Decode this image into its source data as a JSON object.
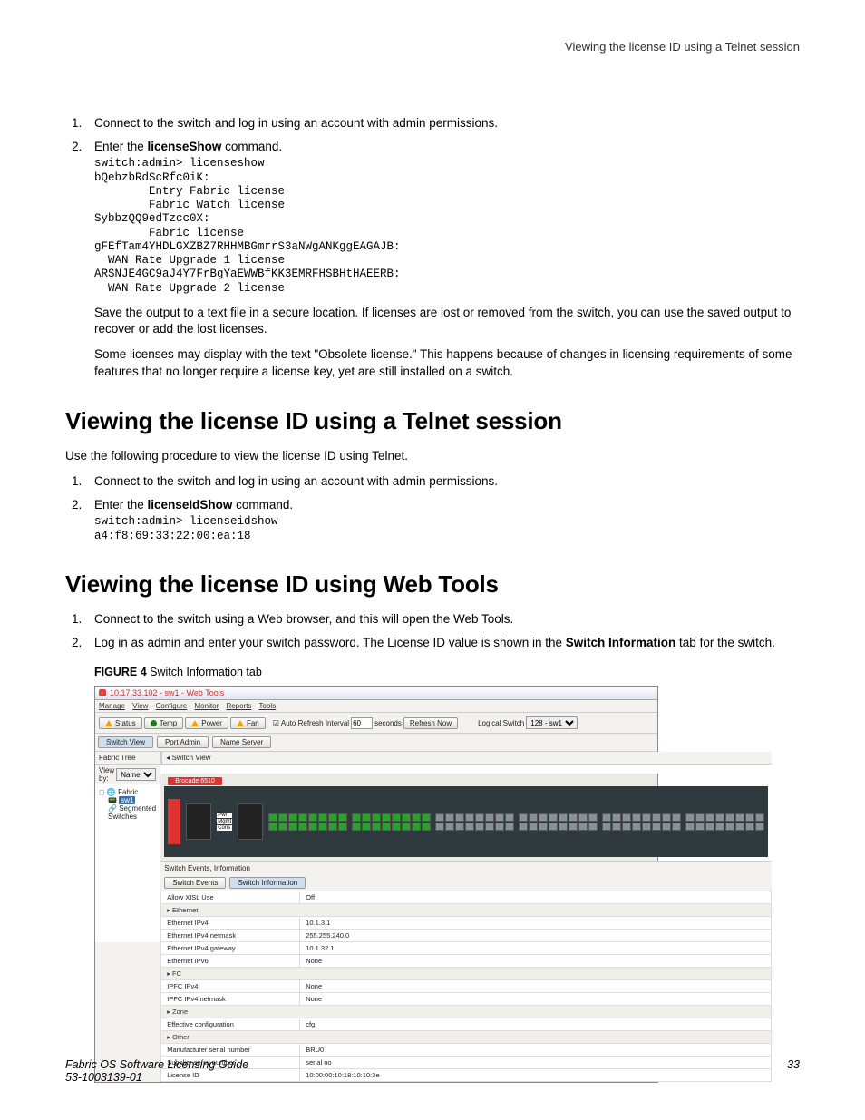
{
  "running_head": "Viewing the license ID using a Telnet session",
  "top_steps": {
    "s1": "Connect to the switch and log in using an account with admin permissions.",
    "s2_prefix": "Enter the ",
    "s2_cmd": "licenseShow",
    "s2_suffix": " command."
  },
  "code1": "switch:admin> licenseshow\nbQebzbRdScRfc0iK:\n        Entry Fabric license\n        Fabric Watch license\nSybbzQQ9edTzcc0X:\n        Fabric license\ngFEfTam4YHDLGXZBZ7RHHMBGmrrS3aNWgANKggEAGAJB:\n  WAN Rate Upgrade 1 license\nARSNJE4GC9aJ4Y7FrBgYaEWWBfKK3EMRFHSBHtHAEERB:\n  WAN Rate Upgrade 2 license",
  "para_save": "Save the output to a text file in a secure location. If licenses are lost or removed from the switch, you can use the saved output to recover or add the lost licenses.",
  "para_obsolete": "Some licenses may display with the text \"Obsolete license.\" This happens because of changes in licensing requirements of some features that no longer require a license key, yet are still installed on a switch.",
  "h_telnet": "Viewing the license ID using a Telnet session",
  "p_telnet_intro": "Use the following procedure to view the license ID using Telnet.",
  "telnet_steps": {
    "s1": "Connect to the switch and log in using an account with admin permissions.",
    "s2_prefix": "Enter the ",
    "s2_cmd": "licenseIdShow",
    "s2_suffix": " command."
  },
  "code2": "switch:admin> licenseidshow\na4:f8:69:33:22:00:ea:18",
  "h_web": "Viewing the license ID using Web Tools",
  "web_steps": {
    "s1": "Connect to the switch using a Web browser, and this will open the Web Tools.",
    "s2_a": "Log in as admin and enter your switch password. The License ID value is shown in the ",
    "s2_b": "Switch Information",
    "s2_c": " tab for the switch."
  },
  "fig_label": "FIGURE 4 ",
  "fig_text": "Switch Information tab",
  "shot": {
    "title": "10.17.33.102 - sw1 - Web Tools",
    "menu": [
      "Manage",
      "View",
      "Configure",
      "Monitor",
      "Reports",
      "Tools"
    ],
    "status_buttons": [
      "Status",
      "Temp",
      "Power",
      "Fan"
    ],
    "auto_refresh_label": "Auto Refresh Interval",
    "auto_refresh_val": "60",
    "seconds": "seconds",
    "refresh_now": "Refresh Now",
    "logical_switch_label": "Logical Switch",
    "logical_switch_val": "128 - sw1",
    "tabs2": [
      "Switch View",
      "Port Admin",
      "Name Server"
    ],
    "fabric_tree": "Fabric Tree",
    "view_by": "View by:",
    "view_by_val": "Name",
    "tree_root": "Fabric",
    "tree_sw": "sw1",
    "tree_seg": "Segmented Switches",
    "switch_view": "Switch View",
    "brocade": "Brocade 6510",
    "sei": "Switch Events, Information",
    "sei_tabs": [
      "Switch Events",
      "Switch Information"
    ],
    "rows": [
      {
        "k": "Allow XISL Use",
        "v": "Off"
      },
      {
        "section": "Ethernet"
      },
      {
        "k": "Ethernet IPv4",
        "v": "10.1.3.1"
      },
      {
        "k": "Ethernet IPv4 netmask",
        "v": "255.255.240.0"
      },
      {
        "k": "Ethernet IPv4 gateway",
        "v": "10.1.32.1"
      },
      {
        "k": "Ethernet IPv6",
        "v": "None"
      },
      {
        "section": "FC"
      },
      {
        "k": "IPFC IPv4",
        "v": "None"
      },
      {
        "k": "IPFC IPv4 netmask",
        "v": "None"
      },
      {
        "section": "Zone"
      },
      {
        "k": "Effective configuration",
        "v": "cfg"
      },
      {
        "section": "Other"
      },
      {
        "k": "Manufacturer serial number",
        "v": "BRU0"
      },
      {
        "k": "Supplier serial number",
        "v": "serial no"
      },
      {
        "k": "License ID",
        "v": "10:00:00:10:18:10:10:3e"
      }
    ]
  },
  "footer_left1": "Fabric OS Software Licensing Guide",
  "footer_left2": "53-1003139-01",
  "footer_right": "33"
}
